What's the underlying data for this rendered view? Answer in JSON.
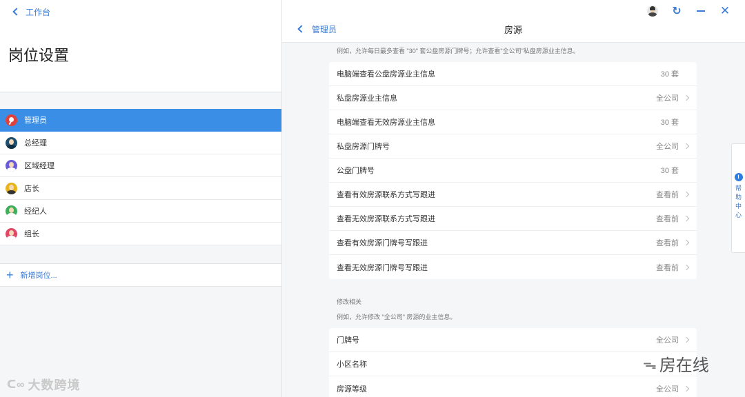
{
  "left": {
    "back_label": "工作台",
    "title": "岗位设置",
    "roles": [
      {
        "label": "管理员",
        "active": true,
        "color": "#e0413b"
      },
      {
        "label": "总经理",
        "active": false,
        "color": "#1f4f6e"
      },
      {
        "label": "区域经理",
        "active": false,
        "color": "#6a5bd7"
      },
      {
        "label": "店长",
        "active": false,
        "color": "#e8b41c"
      },
      {
        "label": "经纪人",
        "active": false,
        "color": "#3cae5c"
      },
      {
        "label": "组长",
        "active": false,
        "color": "#e04868"
      }
    ],
    "add_label": "新增岗位..."
  },
  "header": {
    "back_label": "管理员",
    "title": "房源"
  },
  "view_section": {
    "hint": "例如，允许每日最多查看 \"30\" 套公盘房源门牌号；允许查看\"全公司\"私盘房源业主信息。",
    "rows": [
      {
        "label": "电脑端查看公盘房源业主信息",
        "value": "30 套",
        "arrow": false
      },
      {
        "label": "私盘房源业主信息",
        "value": "全公司",
        "arrow": true
      },
      {
        "label": "电脑端查看无效房源业主信息",
        "value": "30 套",
        "arrow": false
      },
      {
        "label": "私盘房源门牌号",
        "value": "全公司",
        "arrow": true
      },
      {
        "label": "公盘门牌号",
        "value": "30 套",
        "arrow": false
      },
      {
        "label": "查看有效房源联系方式写跟进",
        "value": "查看前",
        "arrow": true
      },
      {
        "label": "查看无效房源联系方式写跟进",
        "value": "查看前",
        "arrow": true
      },
      {
        "label": "查看有效房源门牌号写跟进",
        "value": "查看前",
        "arrow": true
      },
      {
        "label": "查看无效房源门牌号写跟进",
        "value": "查看前",
        "arrow": true
      }
    ]
  },
  "edit_section": {
    "title": "修改相关",
    "hint": "例如，允许修改 \"全公司\" 房源的业主信息。",
    "rows": [
      {
        "label": "门牌号",
        "value": "全公司",
        "arrow": true
      },
      {
        "label": "小区名称",
        "value": "",
        "arrow": false
      },
      {
        "label": "房源等级",
        "value": "全公司",
        "arrow": true
      }
    ]
  },
  "help": {
    "icon": "!",
    "label": "帮助中心"
  },
  "watermarks": {
    "left": "大数跨境",
    "right": "房在线"
  }
}
